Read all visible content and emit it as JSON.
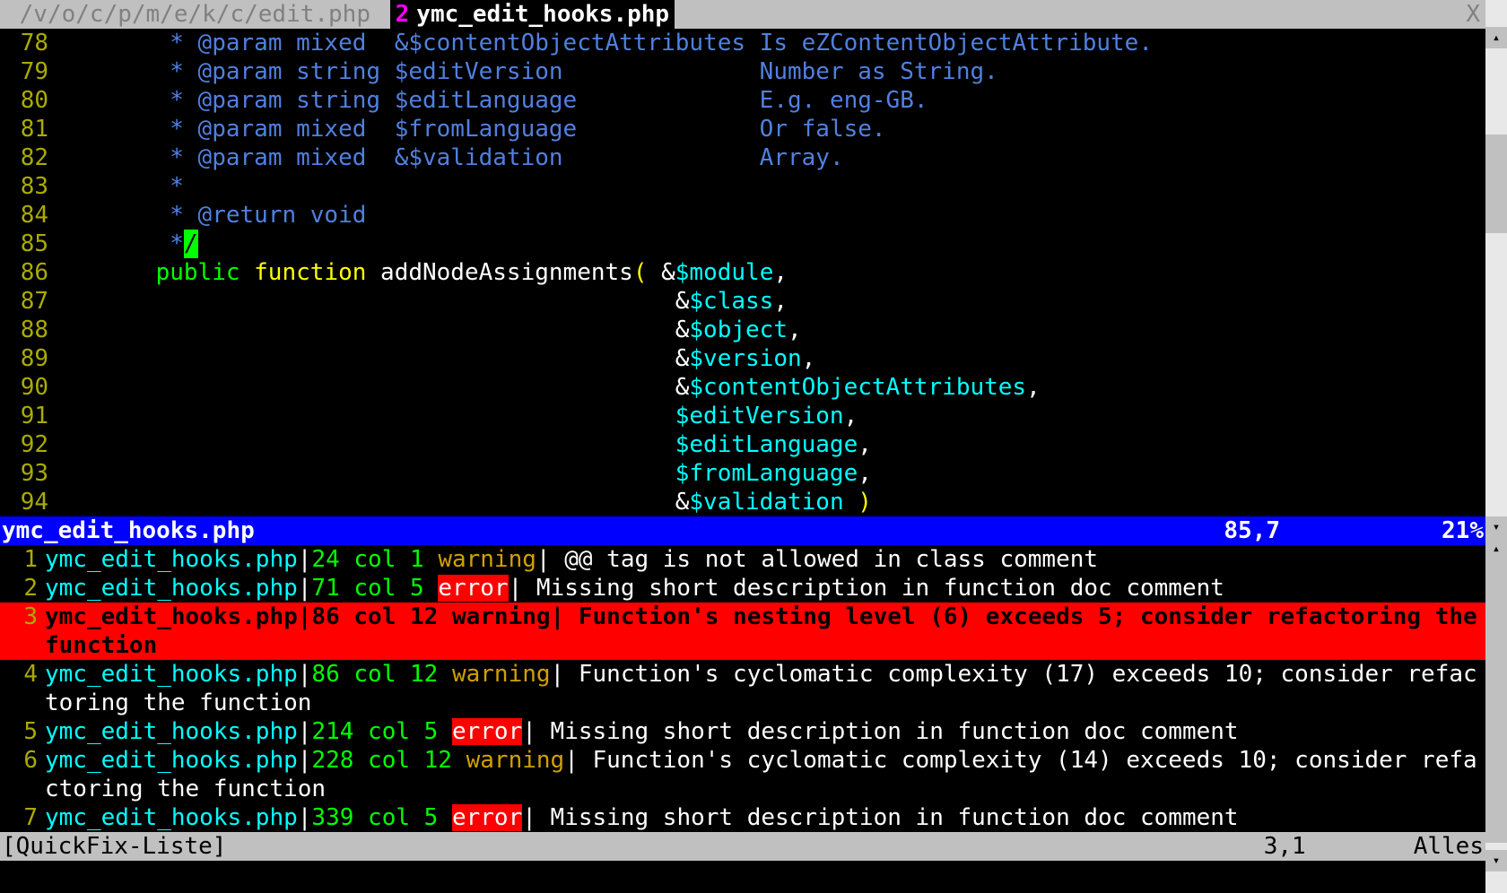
{
  "tabs": {
    "inactive_label": " /v/o/c/p/m/e/k/c/edit.php ",
    "active_num": "2",
    "active_name": "ymc_edit_hooks.php",
    "close_x": "X"
  },
  "code_lines": [
    {
      "n": "78",
      "ind": "        ",
      "segs": [
        {
          "t": "* ",
          "c": "c-comment"
        },
        {
          "t": "@param mixed  ",
          "c": "c-comment"
        },
        {
          "t": "&$contentObjectAttributes",
          "c": "c-comment"
        },
        {
          "t": " Is eZContentObjectAttribute.",
          "c": "c-comment"
        }
      ]
    },
    {
      "n": "79",
      "ind": "        ",
      "segs": [
        {
          "t": "* ",
          "c": "c-comment"
        },
        {
          "t": "@param string $editVersion              Number as String.",
          "c": "c-comment"
        }
      ]
    },
    {
      "n": "80",
      "ind": "        ",
      "segs": [
        {
          "t": "* ",
          "c": "c-comment"
        },
        {
          "t": "@param string $editLanguage             E.g. eng-GB.",
          "c": "c-comment"
        }
      ]
    },
    {
      "n": "81",
      "ind": "        ",
      "segs": [
        {
          "t": "* ",
          "c": "c-comment"
        },
        {
          "t": "@param mixed  $fromLanguage             Or false.",
          "c": "c-comment"
        }
      ]
    },
    {
      "n": "82",
      "ind": "        ",
      "segs": [
        {
          "t": "* ",
          "c": "c-comment"
        },
        {
          "t": "@param mixed  &$validation              Array.",
          "c": "c-comment"
        }
      ]
    },
    {
      "n": "83",
      "ind": "        ",
      "segs": [
        {
          "t": "*",
          "c": "c-comment"
        }
      ]
    },
    {
      "n": "84",
      "ind": "        ",
      "segs": [
        {
          "t": "* ",
          "c": "c-comment"
        },
        {
          "t": "@return void",
          "c": "c-comment"
        }
      ]
    },
    {
      "n": "85",
      "ind": "        ",
      "segs": [
        {
          "t": "*",
          "c": "c-comment"
        },
        {
          "t": "/",
          "c": "cursor"
        }
      ]
    },
    {
      "n": "86",
      "ind": "       ",
      "segs": [
        {
          "t": "public",
          "c": "c-keyword"
        },
        {
          "t": " ",
          "c": "c-white"
        },
        {
          "t": "function",
          "c": "c-keyword2"
        },
        {
          "t": " addNodeAssignments",
          "c": "c-white"
        },
        {
          "t": "(",
          "c": "c-paren"
        },
        {
          "t": " &",
          "c": "c-white"
        },
        {
          "t": "$module",
          "c": "c-var"
        },
        {
          "t": ",",
          "c": "c-white"
        }
      ]
    },
    {
      "n": "87",
      "ind": "                                            ",
      "segs": [
        {
          "t": "&",
          "c": "c-white"
        },
        {
          "t": "$class",
          "c": "c-var"
        },
        {
          "t": ",",
          "c": "c-white"
        }
      ]
    },
    {
      "n": "88",
      "ind": "                                            ",
      "segs": [
        {
          "t": "&",
          "c": "c-white"
        },
        {
          "t": "$object",
          "c": "c-var"
        },
        {
          "t": ",",
          "c": "c-white"
        }
      ]
    },
    {
      "n": "89",
      "ind": "                                            ",
      "segs": [
        {
          "t": "&",
          "c": "c-white"
        },
        {
          "t": "$version",
          "c": "c-var"
        },
        {
          "t": ",",
          "c": "c-white"
        }
      ]
    },
    {
      "n": "90",
      "ind": "                                            ",
      "segs": [
        {
          "t": "&",
          "c": "c-white"
        },
        {
          "t": "$contentObjectAttributes",
          "c": "c-var"
        },
        {
          "t": ",",
          "c": "c-white"
        }
      ]
    },
    {
      "n": "91",
      "ind": "                                            ",
      "segs": [
        {
          "t": "$editVersion",
          "c": "c-var"
        },
        {
          "t": ",",
          "c": "c-white"
        }
      ]
    },
    {
      "n": "92",
      "ind": "                                            ",
      "segs": [
        {
          "t": "$editLanguage",
          "c": "c-var"
        },
        {
          "t": ",",
          "c": "c-white"
        }
      ]
    },
    {
      "n": "93",
      "ind": "                                            ",
      "segs": [
        {
          "t": "$fromLanguage",
          "c": "c-var"
        },
        {
          "t": ",",
          "c": "c-white"
        }
      ]
    },
    {
      "n": "94",
      "ind": "                                            ",
      "segs": [
        {
          "t": "&",
          "c": "c-white"
        },
        {
          "t": "$validation",
          "c": "c-var"
        },
        {
          "t": " ",
          "c": "c-white"
        },
        {
          "t": ")",
          "c": "c-paren"
        }
      ]
    }
  ],
  "status_code": {
    "file": "ymc_edit_hooks.php",
    "pos": "85,7",
    "pct": "21%"
  },
  "quickfix": [
    {
      "n": "1",
      "file": "ymc_edit_hooks.php",
      "loc": "24 col 1",
      "lvl": "warning",
      "lvlc": "qf-warn",
      "msg": " @@ tag is not allowed in class comment",
      "sel": false
    },
    {
      "n": "2",
      "file": "ymc_edit_hooks.php",
      "loc": "71 col 5",
      "lvl": "error",
      "lvlc": "qf-err",
      "msg": " Missing short description in function doc comment",
      "sel": false
    },
    {
      "n": "3",
      "file": "ymc_edit_hooks.php",
      "loc": "86 col 12",
      "lvl": "warning",
      "lvlc": "qf-warn",
      "msg": " Function's nesting level (6) exceeds 5; consider refactoring the function",
      "sel": true
    },
    {
      "n": "4",
      "file": "ymc_edit_hooks.php",
      "loc": "86 col 12",
      "lvl": "warning",
      "lvlc": "qf-warn",
      "msg": " Function's cyclomatic complexity (17) exceeds 10; consider refactoring the function",
      "sel": false
    },
    {
      "n": "5",
      "file": "ymc_edit_hooks.php",
      "loc": "214 col 5",
      "lvl": "error",
      "lvlc": "qf-err",
      "msg": " Missing short description in function doc comment",
      "sel": false
    },
    {
      "n": "6",
      "file": "ymc_edit_hooks.php",
      "loc": "228 col 12",
      "lvl": "warning",
      "lvlc": "qf-warn",
      "msg": " Function's cyclomatic complexity (14) exceeds 10; consider refactoring the function",
      "sel": false
    },
    {
      "n": "7",
      "file": "ymc_edit_hooks.php",
      "loc": "339 col 5",
      "lvl": "error",
      "lvlc": "qf-err",
      "msg": " Missing short description in function doc comment",
      "sel": false
    }
  ],
  "status_qf": {
    "title": "[QuickFix-Liste]",
    "pos": "3,1",
    "pct": "Alles"
  },
  "scroll_glyphs": {
    "up": "▴",
    "down": "▾"
  }
}
